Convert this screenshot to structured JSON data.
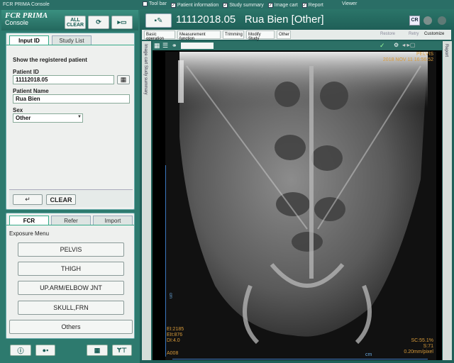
{
  "console": {
    "title": "FCR PRIMA Console",
    "logo_top": "FCR PRIMA",
    "logo_bottom": "Console",
    "all_clear": [
      "ALL",
      "CLEAR"
    ],
    "tabs": [
      "Input ID",
      "Study List"
    ],
    "heading": "Show the registered patient",
    "patient_id_label": "Patient ID",
    "patient_id_value": "11112018.05",
    "patient_name_label": "Patient Name",
    "patient_name_value": "Rua Bien",
    "sex_label": "Sex",
    "sex_value": "Other",
    "enter_symbol": "↵",
    "clear": "CLEAR",
    "menu_tabs": [
      "FCR",
      "Refer",
      "Import"
    ],
    "exposure_menu_label": "Exposure Menu",
    "exposure_items": [
      "PELVIS",
      "THIGH",
      "UP.ARM/ELBOW JNT",
      "SKULL,FRN"
    ],
    "others": "Others"
  },
  "viewer": {
    "title": "Viewer",
    "toolbar_checks": [
      "Tool bar",
      "Patient information",
      "Study summary",
      "Image cart",
      "Report"
    ],
    "patient_id": "11112018.05",
    "patient_name": "Rua Bien [Other]",
    "cr_badge": "CR",
    "tabs": [
      "Basic operation",
      "Measurement function",
      "Trimming",
      "Modify Study",
      "Other"
    ],
    "restore": "Restore",
    "retry": "Retry",
    "customize": "Customize",
    "side_tabs": [
      "Image cart",
      "Study summary"
    ],
    "right_tab": "Report",
    "overlay": {
      "region": "PELVIS",
      "datetime": "2018 NOV 11 16:56:52",
      "ei": "EI:2185",
      "eit": "EIt:876",
      "di": "DI:4.0",
      "sc": "SC:55.1%",
      "s": "S:71",
      "pixel": "0.20mm/pixel",
      "acc": "A008",
      "unit_v": "cm",
      "unit_h": "cm"
    }
  },
  "colors": {
    "chrome": "#2d7a6e",
    "overlay_text": "#d79a3a"
  }
}
